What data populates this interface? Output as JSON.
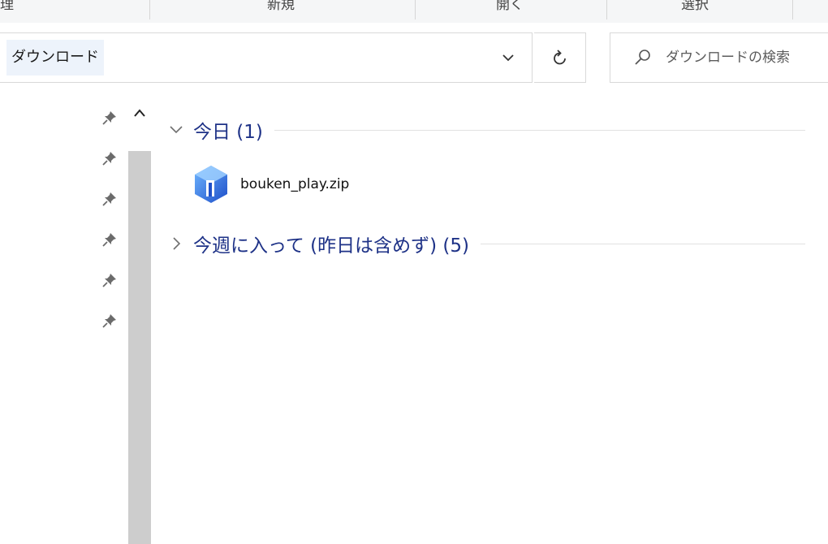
{
  "ribbon": {
    "groups": [
      "理",
      "新規",
      "開く",
      "選択"
    ]
  },
  "address": {
    "crumb": "ダウンロード"
  },
  "search": {
    "placeholder": "ダウンロードの検索"
  },
  "content": {
    "groups": [
      {
        "title": "今日 (1)",
        "expanded": true,
        "items": [
          {
            "name": "bouken_play.zip",
            "icon": "zip-app-icon"
          }
        ]
      },
      {
        "title": "今週に入って (昨日は含めず) (5)",
        "expanded": false,
        "items": []
      }
    ]
  },
  "colors": {
    "group_title": "#1e3287",
    "crumb_highlight": "#edf3fb",
    "scrollbar": "#cdcdcd",
    "icon_blue": "#2f6fe0"
  }
}
